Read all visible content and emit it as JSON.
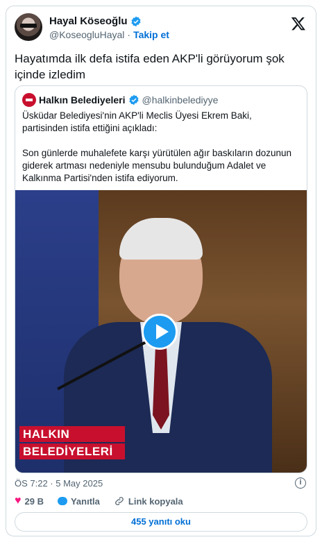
{
  "author": {
    "display_name": "Hayal Köseoğlu",
    "handle": "@KoseogluHayal",
    "separator": "·",
    "follow_label": "Takip et"
  },
  "tweet": {
    "text": "Hayatımda ilk defa istifa eden AKP'li görüyorum şok içinde izledim"
  },
  "quoted": {
    "display_name": "Halkın Belediyeleri",
    "handle": "@halkinbelediyye",
    "paragraph1": "Üsküdar Belediyesi'nin AKP'li Meclis Üyesi Ekrem Baki, partisinden istifa ettiğini açıkladı:",
    "paragraph2": "Son günlerde muhalefete karşı yürütülen ağır baskıların dozunun giderek artması nedeniyle mensubu bulunduğum Adalet ve Kalkınma Partisi'nden istifa ediyorum.",
    "video_brand_line1": "HALKIN",
    "video_brand_line2": "BELEDİYELERİ"
  },
  "meta": {
    "timestamp": "ÖS 7:22 · 5 May 2025"
  },
  "actions": {
    "likes": "29 B",
    "reply_label": "Yanıtla",
    "copy_link_label": "Link kopyala"
  },
  "replies_button": "455 yanıtı oku",
  "colors": {
    "accent": "#1d9bf0",
    "link": "#006fd6",
    "like": "#f91880",
    "brand_red": "#c8102e"
  },
  "icons": [
    "verified-badge-icon",
    "x-logo-icon",
    "play-icon",
    "info-icon",
    "heart-icon",
    "reply-bubble-icon",
    "link-icon"
  ]
}
